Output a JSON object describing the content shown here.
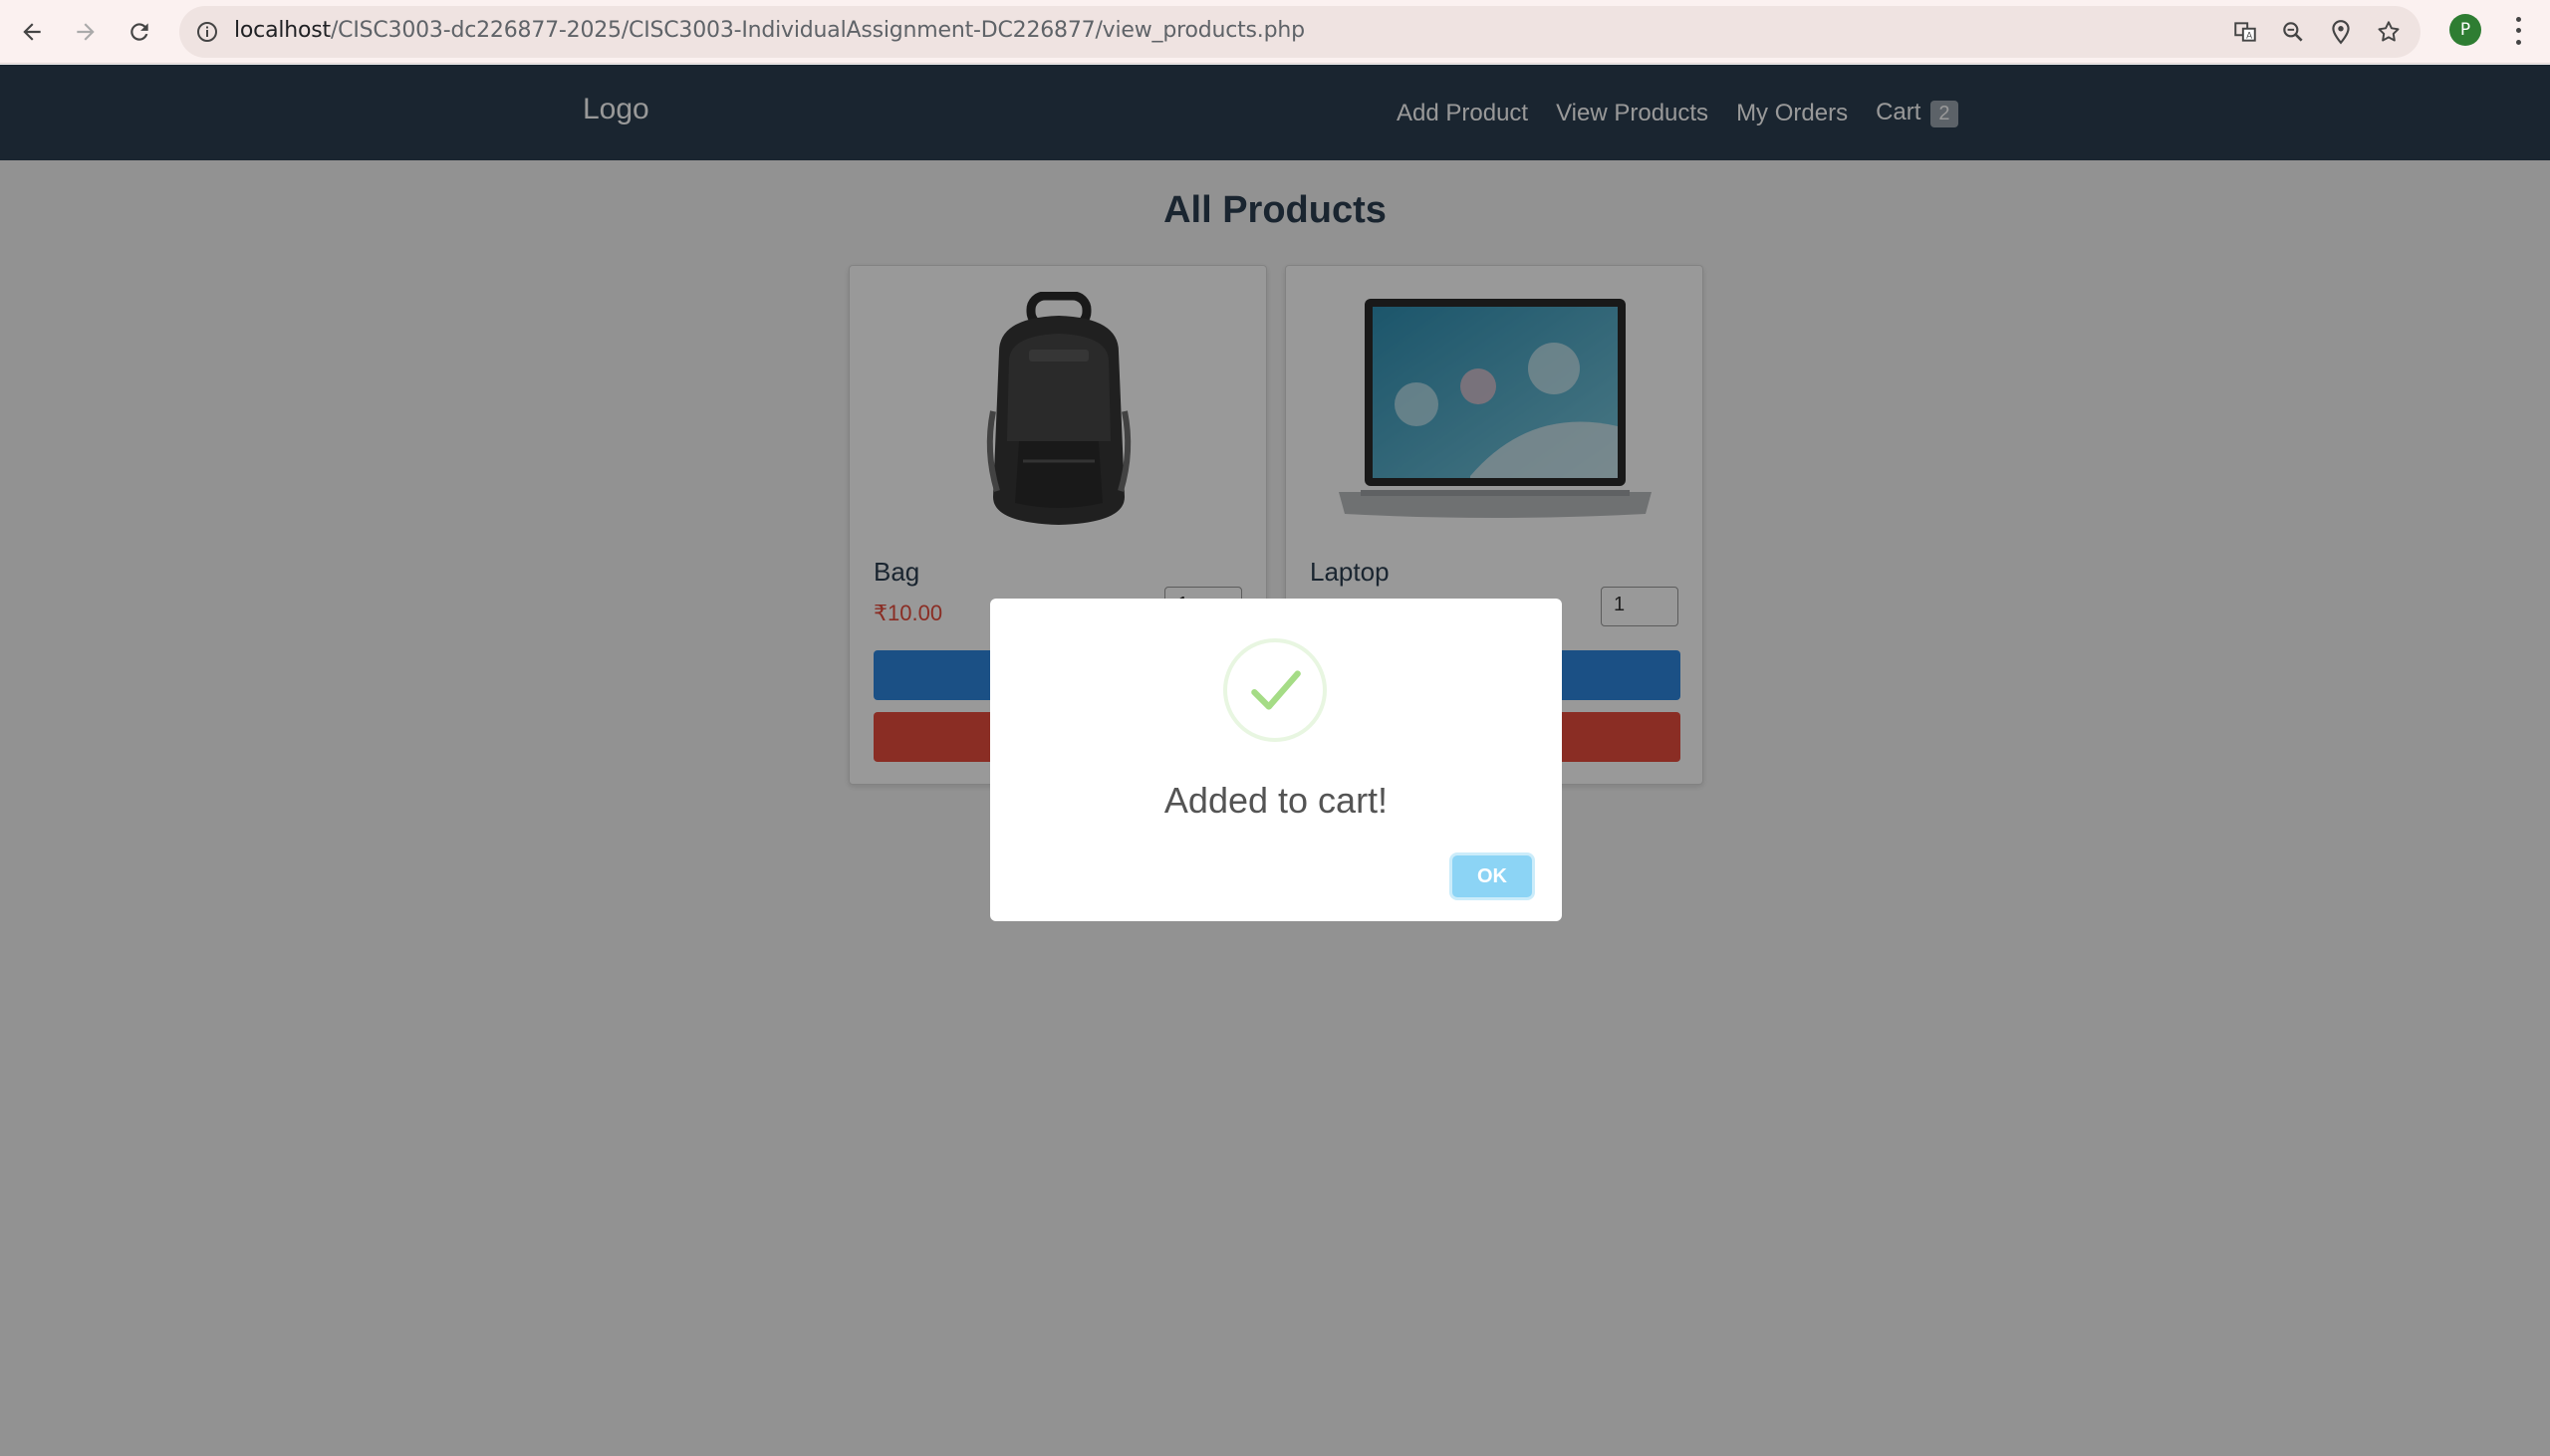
{
  "browser": {
    "url_host": "localhost",
    "url_path": "/CISC3003-dc226877-2025/CISC3003-IndividualAssignment-DC226877/view_products.php",
    "profile_initial": "P"
  },
  "header": {
    "logo": "Logo",
    "nav": {
      "add_product": "Add Product",
      "view_products": "View Products",
      "my_orders": "My Orders",
      "cart": "Cart",
      "cart_count": "2"
    }
  },
  "main": {
    "title": "All Products",
    "products": [
      {
        "name": "Bag",
        "price": "₹10.00",
        "quantity": "1"
      },
      {
        "name": "Laptop",
        "quantity": "1"
      }
    ]
  },
  "modal": {
    "title": "Added to cart!",
    "ok_label": "OK",
    "icon": "success-check-icon"
  },
  "colors": {
    "header_bg": "#2c3e50",
    "add_button": "#2e86de",
    "buy_button": "#e74c3c",
    "price": "#e74c3c",
    "ok_button": "#8cd4f5",
    "check": "#a5dc86"
  }
}
